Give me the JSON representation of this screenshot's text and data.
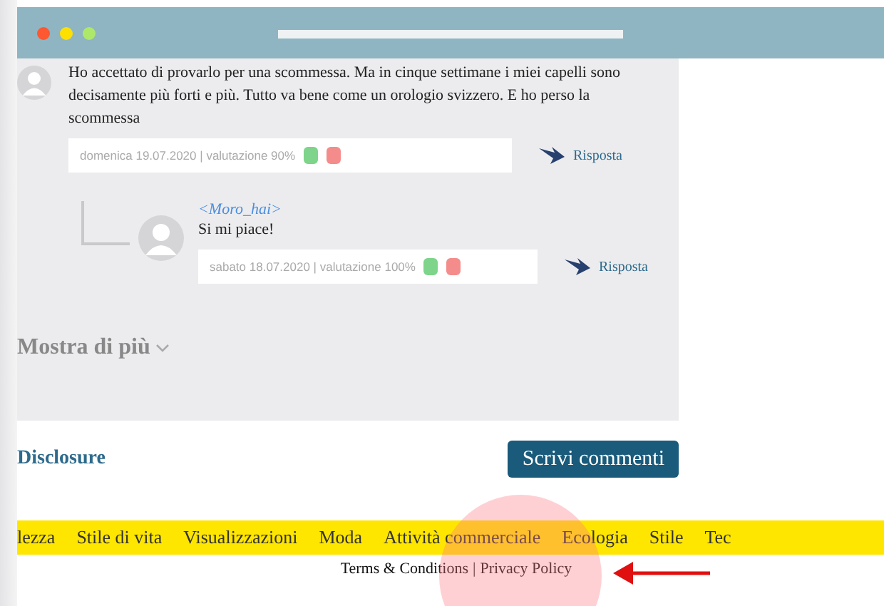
{
  "comments": [
    {
      "text": "Ho accettato di provarlo per una scommessa. Ma in cinque settimane i miei capelli sono decisamente più forti e più. Tutto va bene come un orologio svizzero. E ho perso la scommessa",
      "meta": "domenica 19.07.2020 | valutazione 90%",
      "reply": "Risposta",
      "is_reply": false
    },
    {
      "author": "<Moro_hai>",
      "text": "Si mi piace!",
      "meta": "sabato 18.07.2020 | valutazione 100%",
      "reply": "Risposta",
      "is_reply": true
    }
  ],
  "show_more": "Mostra di più",
  "disclosure": "Disclosure",
  "write_button": "Scrivi commenti",
  "nav": [
    {
      "label": "lezza"
    },
    {
      "label": "Stile di vita"
    },
    {
      "label": "Visualizzazioni"
    },
    {
      "label": "Moda"
    },
    {
      "label": "Attività commerciale"
    },
    {
      "label": "Ecologia"
    },
    {
      "label": "Stile"
    },
    {
      "label": "Tec"
    }
  ],
  "footer": {
    "terms": "Terms & Conditions",
    "separator": "|",
    "privacy": "Privacy Policy"
  }
}
